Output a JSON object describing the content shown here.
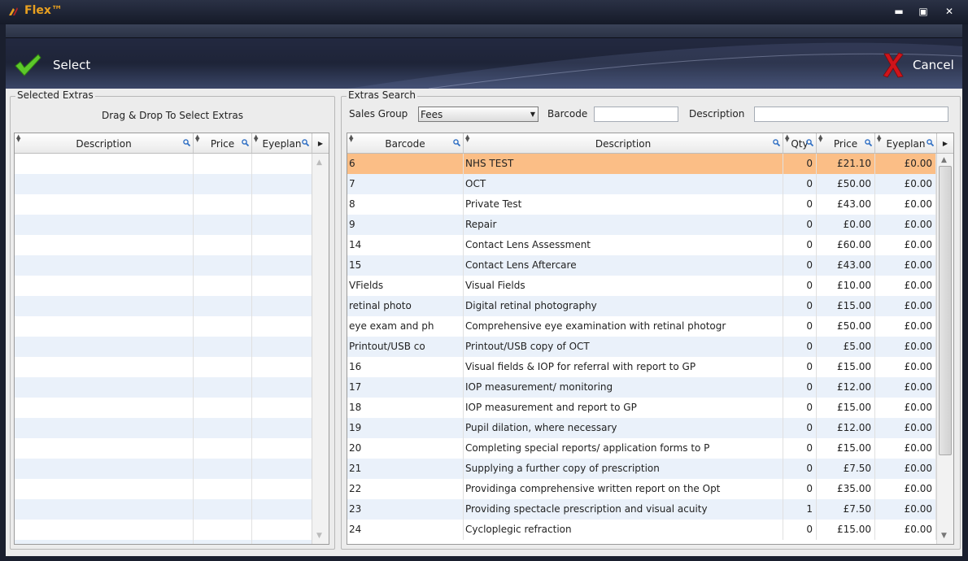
{
  "window": {
    "title": "Flex™"
  },
  "toolbar": {
    "select_label": "Select",
    "cancel_label": "Cancel"
  },
  "selected_extras": {
    "group_title": "Selected Extras",
    "hint": "Drag & Drop To Select Extras",
    "columns": [
      "Description",
      "Price",
      "Eyeplan"
    ]
  },
  "extras_search": {
    "group_title": "Extras Search",
    "sales_group_label": "Sales Group",
    "sales_group_value": "Fees",
    "barcode_label": "Barcode",
    "barcode_value": "",
    "description_label": "Description",
    "description_value": "",
    "columns": [
      "Barcode",
      "Description",
      "Qty",
      "Price",
      "Eyeplan"
    ],
    "rows": [
      {
        "barcode": "6",
        "description": "NHS TEST",
        "qty": "0",
        "price": "£21.10",
        "eyeplan": "£0.00",
        "selected": true
      },
      {
        "barcode": "7",
        "description": "OCT",
        "qty": "0",
        "price": "£50.00",
        "eyeplan": "£0.00"
      },
      {
        "barcode": "8",
        "description": "Private Test",
        "qty": "0",
        "price": "£43.00",
        "eyeplan": "£0.00"
      },
      {
        "barcode": "9",
        "description": "Repair",
        "qty": "0",
        "price": "£0.00",
        "eyeplan": "£0.00"
      },
      {
        "barcode": "14",
        "description": "Contact Lens Assessment",
        "qty": "0",
        "price": "£60.00",
        "eyeplan": "£0.00"
      },
      {
        "barcode": "15",
        "description": "Contact Lens Aftercare",
        "qty": "0",
        "price": "£43.00",
        "eyeplan": "£0.00"
      },
      {
        "barcode": "VFields",
        "description": "Visual Fields",
        "qty": "0",
        "price": "£10.00",
        "eyeplan": "£0.00"
      },
      {
        "barcode": "retinal photo",
        "description": "Digital retinal photography",
        "qty": "0",
        "price": "£15.00",
        "eyeplan": "£0.00"
      },
      {
        "barcode": "eye exam and ph",
        "description": "Comprehensive eye examination with retinal photogr",
        "qty": "0",
        "price": "£50.00",
        "eyeplan": "£0.00"
      },
      {
        "barcode": "Printout/USB co",
        "description": "Printout/USB copy of OCT",
        "qty": "0",
        "price": "£5.00",
        "eyeplan": "£0.00"
      },
      {
        "barcode": "16",
        "description": "Visual fields & IOP for referral with report to GP",
        "qty": "0",
        "price": "£15.00",
        "eyeplan": "£0.00"
      },
      {
        "barcode": "17",
        "description": "IOP measurement/ monitoring",
        "qty": "0",
        "price": "£12.00",
        "eyeplan": "£0.00"
      },
      {
        "barcode": "18",
        "description": "IOP measurement and report to GP",
        "qty": "0",
        "price": "£15.00",
        "eyeplan": "£0.00"
      },
      {
        "barcode": "19",
        "description": "Pupil dilation, where necessary",
        "qty": "0",
        "price": "£12.00",
        "eyeplan": "£0.00"
      },
      {
        "barcode": "20",
        "description": "Completing special reports/ application forms to P",
        "qty": "0",
        "price": "£15.00",
        "eyeplan": "£0.00"
      },
      {
        "barcode": "21",
        "description": "Supplying a further copy of prescription",
        "qty": "0",
        "price": "£7.50",
        "eyeplan": "£0.00"
      },
      {
        "barcode": "22",
        "description": "Providinga comprehensive written report on the Opt",
        "qty": "0",
        "price": "£35.00",
        "eyeplan": "£0.00"
      },
      {
        "barcode": "23",
        "description": "Providing spectacle prescription and visual acuity",
        "qty": "1",
        "price": "£7.50",
        "eyeplan": "£0.00"
      },
      {
        "barcode": "24",
        "description": "Cycloplegic refraction",
        "qty": "0",
        "price": "£15.00",
        "eyeplan": "£0.00"
      }
    ]
  },
  "colors": {
    "selected_row": "#fbbe86",
    "alt_row": "#eaf1fa",
    "title_text": "#e8a020",
    "search_icon": "#2f6fc4"
  },
  "icons": [
    "flex-logo-icon",
    "minimize-icon",
    "maximize-icon",
    "close-icon",
    "checkmark-icon",
    "red-x-icon",
    "search-icon",
    "sort-icon",
    "scroll-up-icon",
    "scroll-down-icon",
    "scroll-right-icon"
  ]
}
